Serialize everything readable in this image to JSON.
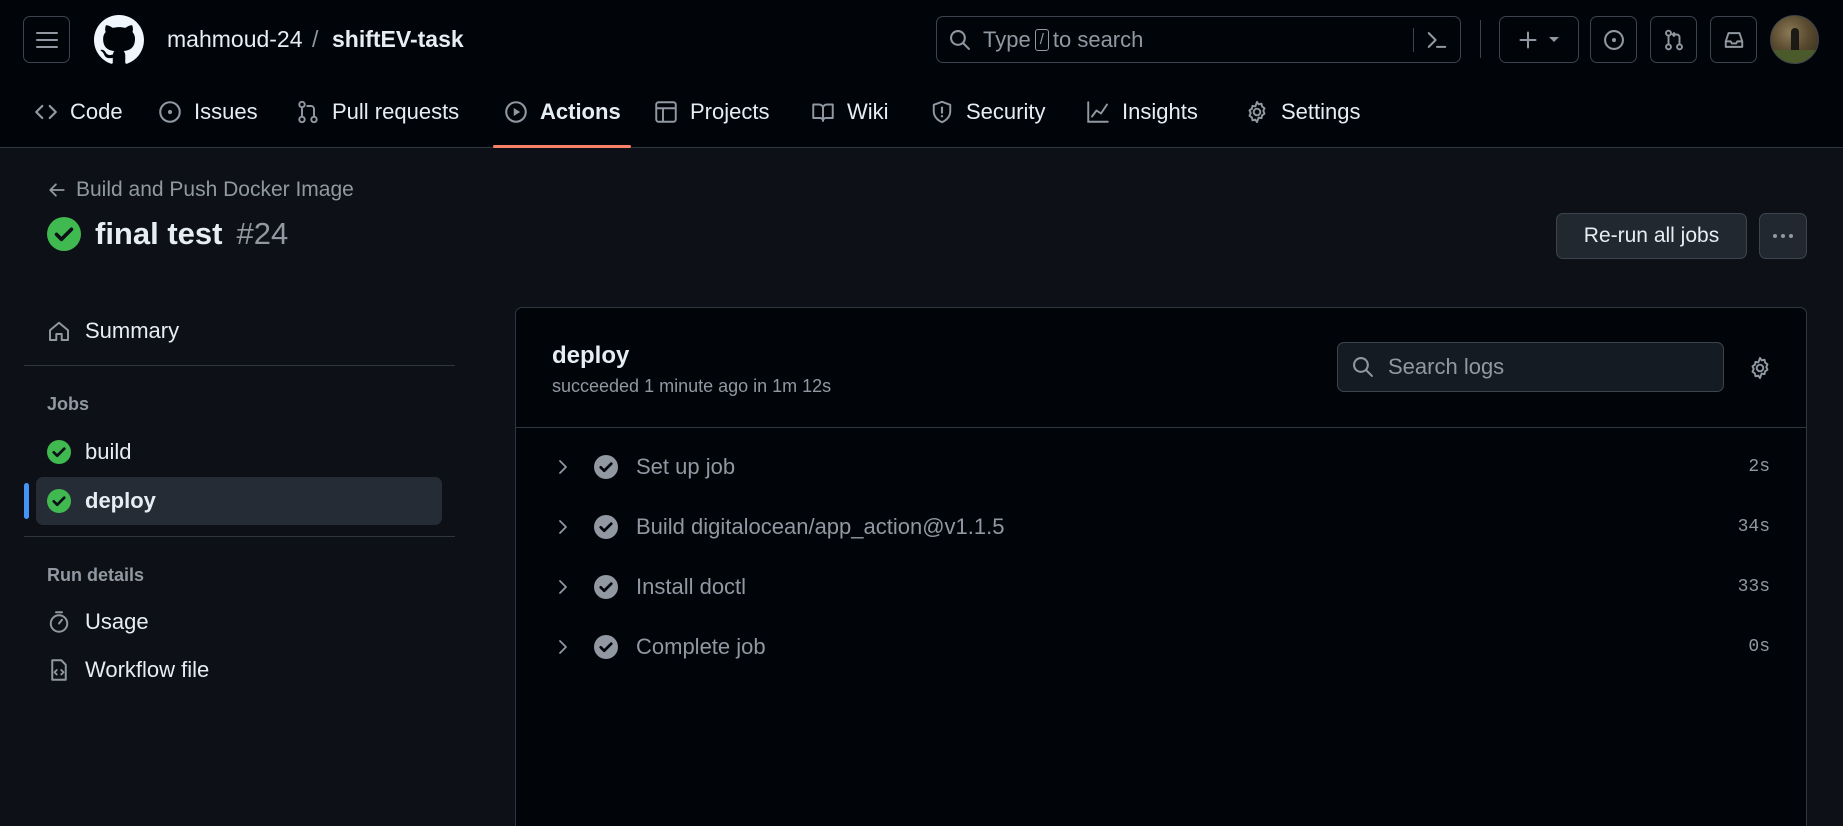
{
  "header": {
    "owner": "mahmoud-24",
    "separator": "/",
    "repo": "shiftEV-task",
    "search": {
      "prefix": "Type",
      "key": "/",
      "suffix": "to search"
    }
  },
  "nav": {
    "tabs": [
      {
        "label": "Code",
        "icon": "code-icon"
      },
      {
        "label": "Issues",
        "icon": "issue-icon"
      },
      {
        "label": "Pull requests",
        "icon": "pull-request-icon"
      },
      {
        "label": "Actions",
        "icon": "play-icon",
        "active": true
      },
      {
        "label": "Projects",
        "icon": "table-icon"
      },
      {
        "label": "Wiki",
        "icon": "book-icon"
      },
      {
        "label": "Security",
        "icon": "shield-icon"
      },
      {
        "label": "Insights",
        "icon": "graph-icon"
      },
      {
        "label": "Settings",
        "icon": "gear-icon"
      }
    ]
  },
  "run": {
    "workflow_name": "Build and Push Docker Image",
    "title": "final test",
    "number": "#24",
    "rerun_label": "Re-run all jobs"
  },
  "sidebar": {
    "summary": "Summary",
    "jobs_heading": "Jobs",
    "jobs": [
      {
        "label": "build",
        "status": "success"
      },
      {
        "label": "deploy",
        "status": "success",
        "active": true
      }
    ],
    "run_details_heading": "Run details",
    "usage": "Usage",
    "workflow_file": "Workflow file"
  },
  "job": {
    "name": "deploy",
    "status_text": "succeeded 1 minute ago in 1m 12s",
    "search_placeholder": "Search logs",
    "steps": [
      {
        "name": "Set up job",
        "duration": "2s"
      },
      {
        "name": "Build digitalocean/app_action@v1.1.5",
        "duration": "34s"
      },
      {
        "name": "Install doctl",
        "duration": "33s"
      },
      {
        "name": "Complete job",
        "duration": "0s"
      }
    ]
  },
  "colors": {
    "success": "#3fb950",
    "accent_underline": "#f78166",
    "active_bar": "#4493f8"
  }
}
